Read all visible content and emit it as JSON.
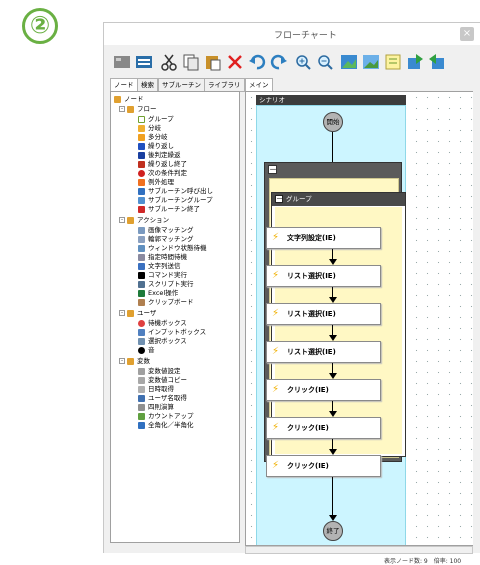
{
  "step_number": "②",
  "window": {
    "title": "フローチャート",
    "close_label": "×"
  },
  "toolbar": {
    "icons": [
      "table-icon",
      "dark-table-icon",
      "cut-icon",
      "copy-icon",
      "paste-icon",
      "delete-icon",
      "undo-icon",
      "redo-icon",
      "zoom-in-icon",
      "zoom-out-icon",
      "image-icon",
      "image2-icon",
      "note-icon",
      "export-icon",
      "import-icon"
    ]
  },
  "tabs": {
    "nodes": "ノード",
    "search": "検索",
    "subroutine": "サブルーチン",
    "library": "ライブラリ",
    "main": "メイン"
  },
  "tree": {
    "root": "ノード",
    "flow": "フロー",
    "flow_items": [
      "グループ",
      "分岐",
      "多分岐",
      "繰り返し",
      "後判定繰返",
      "繰り返し終了",
      "次の条件判定",
      "例外処理",
      "サブルーチン呼び出し",
      "サブルーチングループ",
      "サブルーチン終了"
    ],
    "action": "アクション",
    "action_items": [
      "画像マッチング",
      "輪郭マッチング",
      "ウィンドウ状態待機",
      "指定時間待機",
      "文字列送信",
      "コマンド実行",
      "スクリプト実行",
      "Excel操作",
      "クリップボード"
    ],
    "user": "ユーザ",
    "user_items": [
      "待機ボックス",
      "インプットボックス",
      "選択ボックス",
      "音"
    ],
    "variable": "変数",
    "variable_items": [
      "変数値設定",
      "変数値コピー",
      "日時取得",
      "ユーザ名取得",
      "四則演算",
      "カウントアップ",
      "全角化／半角化"
    ]
  },
  "flow": {
    "scenario_label": "シナリオ",
    "start_label": "開始",
    "end_label": "終了",
    "outer_toggle": "－",
    "group_label": "グループ",
    "group_toggle": "－",
    "steps": [
      "文字列設定(IE)",
      "リスト選択(IE)",
      "リスト選択(IE)",
      "リスト選択(IE)",
      "クリック(IE)",
      "クリック(IE)",
      "クリック(IE)"
    ]
  },
  "status": {
    "text": "表示ノード数: 9　倍率: 100"
  },
  "colors": {
    "step_ring": "#6ab043",
    "scenario_bg": "#ccf5ff",
    "group_body": "#fff8c4",
    "header_dark": "#3c3c3c"
  }
}
